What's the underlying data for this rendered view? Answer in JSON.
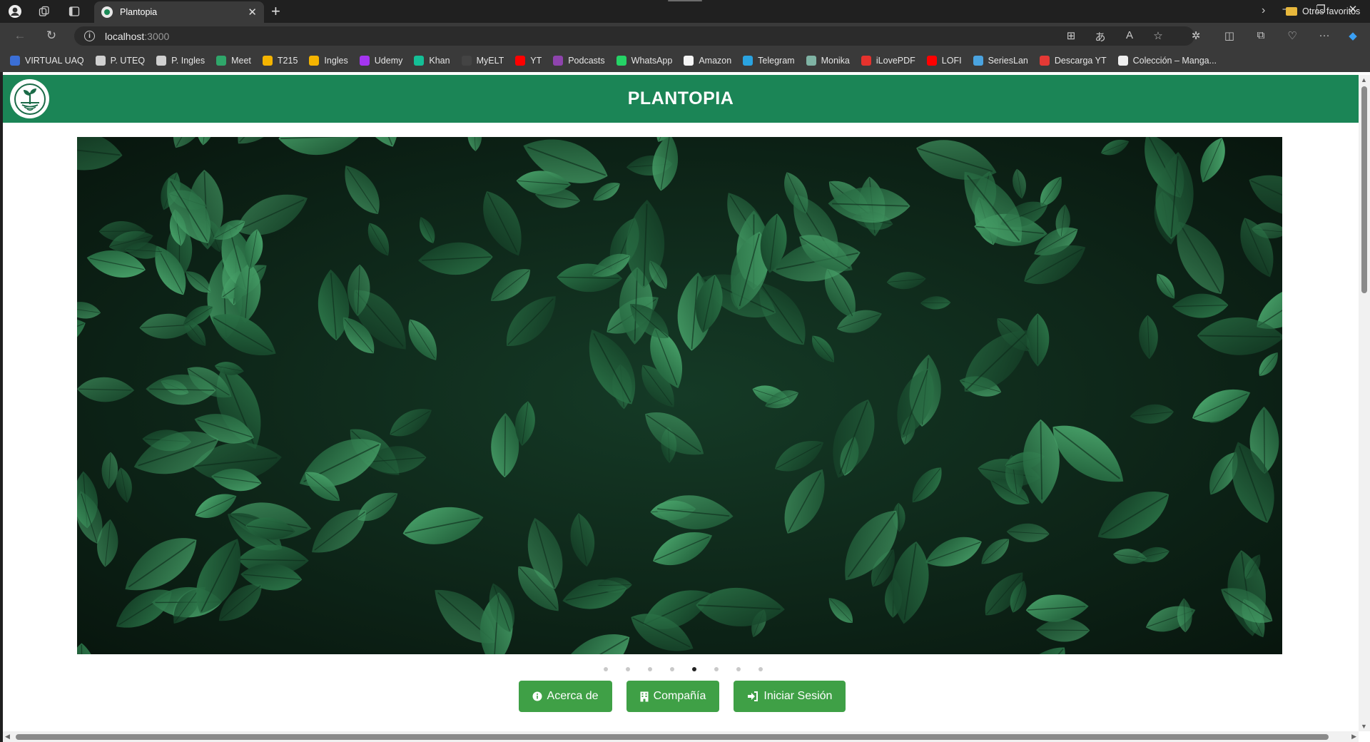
{
  "browser": {
    "tab_title": "Plantopia",
    "url_host": "localhost",
    "url_port": ":3000",
    "bookmarks": [
      {
        "label": "VIRTUAL UAQ",
        "color": "#3b6fd6"
      },
      {
        "label": "P. UTEQ",
        "color": "#d0d0d0"
      },
      {
        "label": "P. Ingles",
        "color": "#d0d0d0"
      },
      {
        "label": "Meet",
        "color": "#2fa66a"
      },
      {
        "label": "T215",
        "color": "#f4b400"
      },
      {
        "label": "Ingles",
        "color": "#f4b400"
      },
      {
        "label": "Udemy",
        "color": "#a435f0"
      },
      {
        "label": "Khan",
        "color": "#14bf96"
      },
      {
        "label": "MyELT",
        "color": "#444444"
      },
      {
        "label": "YT",
        "color": "#ff0000"
      },
      {
        "label": "Podcasts",
        "color": "#8e44ad"
      },
      {
        "label": "WhatsApp",
        "color": "#25d366"
      },
      {
        "label": "Amazon",
        "color": "#f5f5f5"
      },
      {
        "label": "Telegram",
        "color": "#2aa3e0"
      },
      {
        "label": "Monika",
        "color": "#7fb3a4"
      },
      {
        "label": "iLovePDF",
        "color": "#e5322d"
      },
      {
        "label": "LOFI",
        "color": "#ff0000"
      },
      {
        "label": "SeriesLan",
        "color": "#4aa3df"
      },
      {
        "label": "Descarga YT",
        "color": "#e53935"
      },
      {
        "label": "Colección – Manga...",
        "color": "#eeeeee"
      }
    ],
    "other_favorites": "Otros favoritos"
  },
  "site": {
    "title": "PLANTOPIA",
    "brand_color": "#1b8556",
    "carousel": {
      "total": 8,
      "active_index": 5
    },
    "buttons": {
      "about": "Acerca de",
      "company": "Compañía",
      "login": "Iniciar Sesión"
    }
  }
}
